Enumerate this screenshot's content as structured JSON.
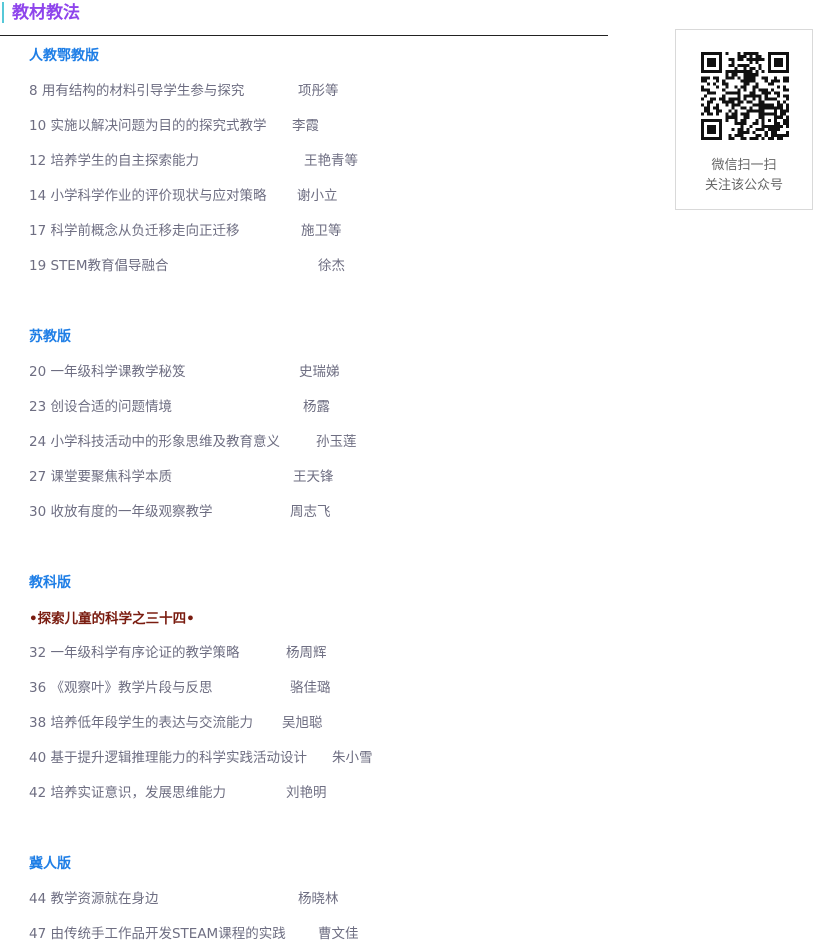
{
  "header": {
    "title": "教材教法"
  },
  "sections": [
    {
      "title": "人教鄂教版",
      "articles": [
        {
          "text": "8 用有结构的材料引导学生参与探究",
          "author": "项彤等"
        },
        {
          "text": "10 实施以解决问题为目的的探究式教学",
          "author": "李霞"
        },
        {
          "text": "12 培养学生的自主探索能力",
          "author": "王艳青等"
        },
        {
          "text": "14 小学科学作业的评价现状与应对策略",
          "author": "谢小立"
        },
        {
          "text": "17 科学前概念从负迁移走向正迁移",
          "author": "施卫等"
        },
        {
          "text": "19 STEM教育倡导融合",
          "author": "徐杰"
        }
      ]
    },
    {
      "title": "苏教版",
      "articles": [
        {
          "text": "20 一年级科学课教学秘笈",
          "author": "史瑞娣"
        },
        {
          "text": "23 创设合适的问题情境",
          "author": "杨露"
        },
        {
          "text": "24 小学科技活动中的形象思维及教育意义",
          "author": "孙玉莲"
        },
        {
          "text": "27 课堂要聚焦科学本质",
          "author": "王天锋"
        },
        {
          "text": "30 收放有度的一年级观察教学",
          "author": "周志飞"
        }
      ]
    },
    {
      "title": "教科版",
      "special": "•探索儿童的科学之三十四•",
      "articles": [
        {
          "text": "32 一年级科学有序论证的教学策略",
          "author": "杨周辉"
        },
        {
          "text": "36 《观察叶》教学片段与反思",
          "author": "骆佳璐"
        },
        {
          "text": "38 培养低年段学生的表达与交流能力",
          "author": "吴旭聪"
        },
        {
          "text": "40 基于提升逻辑推理能力的科学实践活动设计",
          "author": "朱小雪"
        },
        {
          "text": "42 培养实证意识，发展思维能力",
          "author": "刘艳明"
        }
      ]
    },
    {
      "title": "冀人版",
      "articles": [
        {
          "text": "44 教学资源就在身边",
          "author": "杨晓林"
        },
        {
          "text": "47 由传统手工作品开发STEAM课程的实践",
          "author": "曹文佳"
        }
      ]
    }
  ],
  "qr": {
    "icon": "qr-code-icon",
    "caption_line1": "微信扫一扫",
    "caption_line2": "关注该公众号"
  }
}
